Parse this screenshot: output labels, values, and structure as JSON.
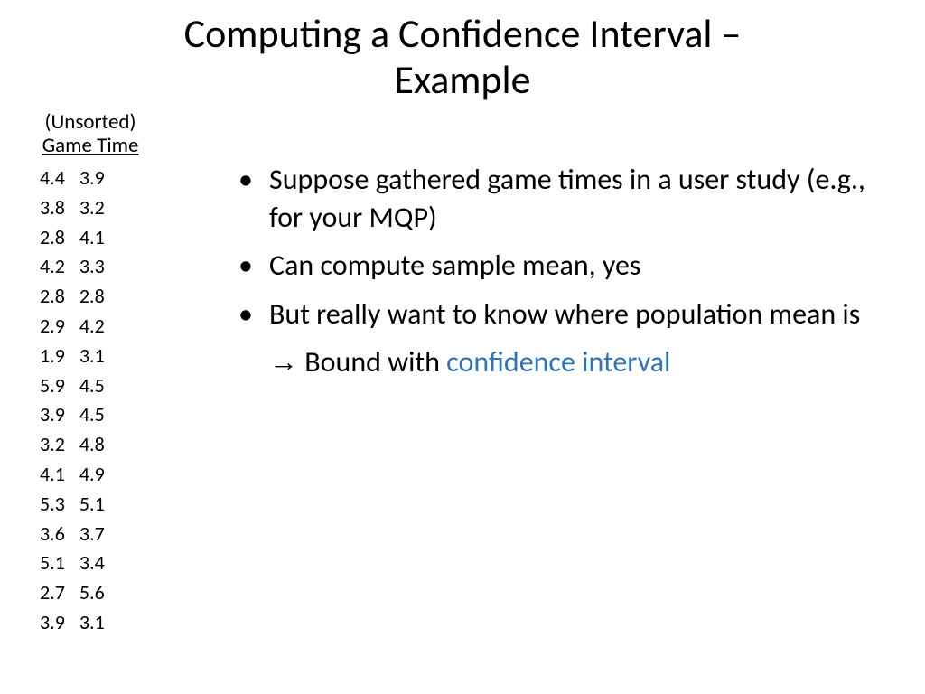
{
  "title_line1": "Computing a Confidence Interval –",
  "title_line2": "Example",
  "table": {
    "header_line1": "(Unsorted)",
    "header_line2": "Game Time",
    "rows": [
      [
        "4.4",
        "3.9"
      ],
      [
        "3.8",
        "3.2"
      ],
      [
        "2.8",
        "4.1"
      ],
      [
        "4.2",
        "3.3"
      ],
      [
        "2.8",
        "2.8"
      ],
      [
        "2.9",
        "4.2"
      ],
      [
        "1.9",
        "3.1"
      ],
      [
        "5.9",
        "4.5"
      ],
      [
        "3.9",
        "4.5"
      ],
      [
        "3.2",
        "4.8"
      ],
      [
        "4.1",
        "4.9"
      ],
      [
        "5.3",
        "5.1"
      ],
      [
        "3.6",
        "3.7"
      ],
      [
        "5.1",
        "3.4"
      ],
      [
        "2.7",
        "5.6"
      ],
      [
        "3.9",
        "3.1"
      ]
    ]
  },
  "bullets": {
    "b1": "Suppose gathered game times in a user study (e.g., for your MQP)",
    "b2": "Can compute sample mean, yes",
    "b3": "But really want to know where population mean is",
    "arrow_glyph": "→",
    "arrow_text": " Bound with ",
    "arrow_highlight": "confidence interval"
  }
}
